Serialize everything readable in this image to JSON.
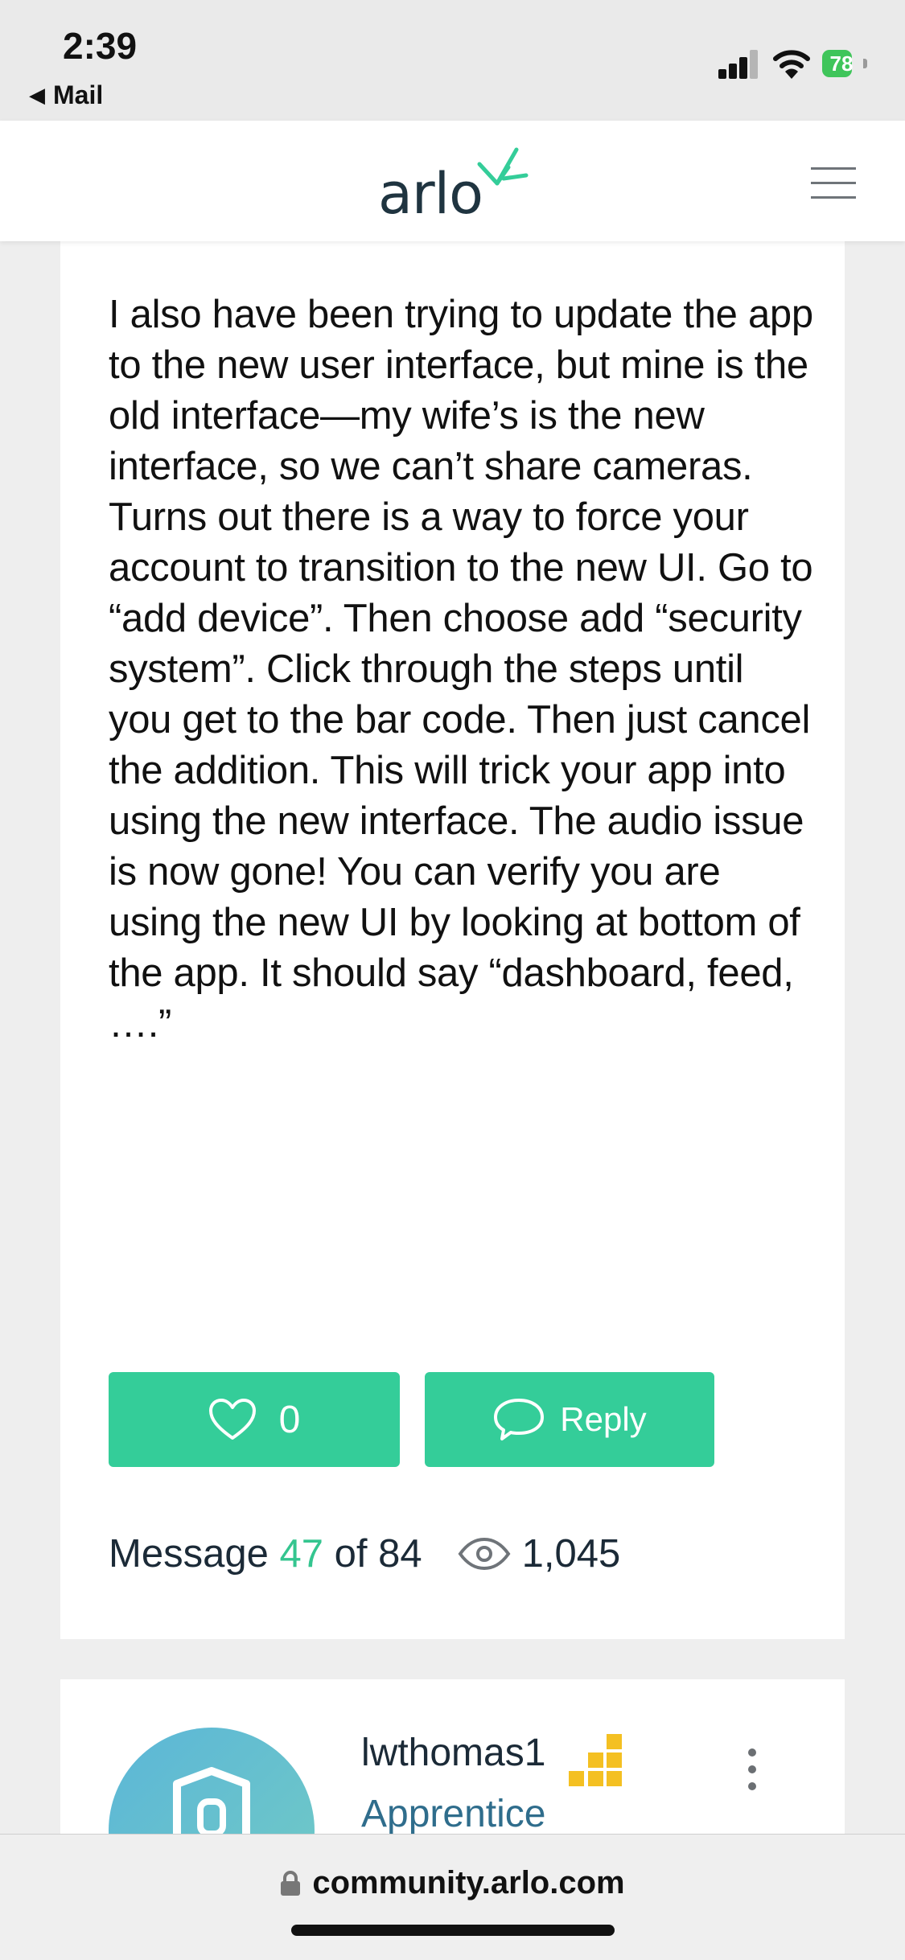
{
  "status_bar": {
    "time": "2:39",
    "back_app": "Mail",
    "battery_percent": "78",
    "battery_color": "#3fc55a",
    "signal_icon": "cellular-signal-icon",
    "wifi_icon": "wifi-icon"
  },
  "header": {
    "logo_text": "arlo",
    "logo_icon": "arlo-bird-icon",
    "menu_icon": "hamburger-menu-icon",
    "brand_color": "#34cd99"
  },
  "post": {
    "body": "I also have been trying to update the app to the new user interface, but mine is the old interface—my wife’s is the new interface, so we can’t share cameras.  Turns out there is a way to force your account to transition to the new UI.  Go to “add device”.  Then choose add “security system”.  Click through the steps until you get to the bar code.  Then just cancel the addition.  This will trick your app into using the new interface.  The audio issue is now gone!  You can verify you are using the new UI by looking at bottom of the app.  It should say “dashboard, feed, ….”",
    "like_count": "0",
    "reply_label": "Reply",
    "message_label": "Message",
    "message_number": "47",
    "message_of": "of",
    "message_total": "84",
    "views": "1,045"
  },
  "author": {
    "username": "lwthomas1",
    "rank": "Apprentice",
    "rank_icon": "rank-blocks-icon",
    "rank_icon_color": "#f4c022"
  },
  "browser": {
    "url": "community.arlo.com"
  }
}
